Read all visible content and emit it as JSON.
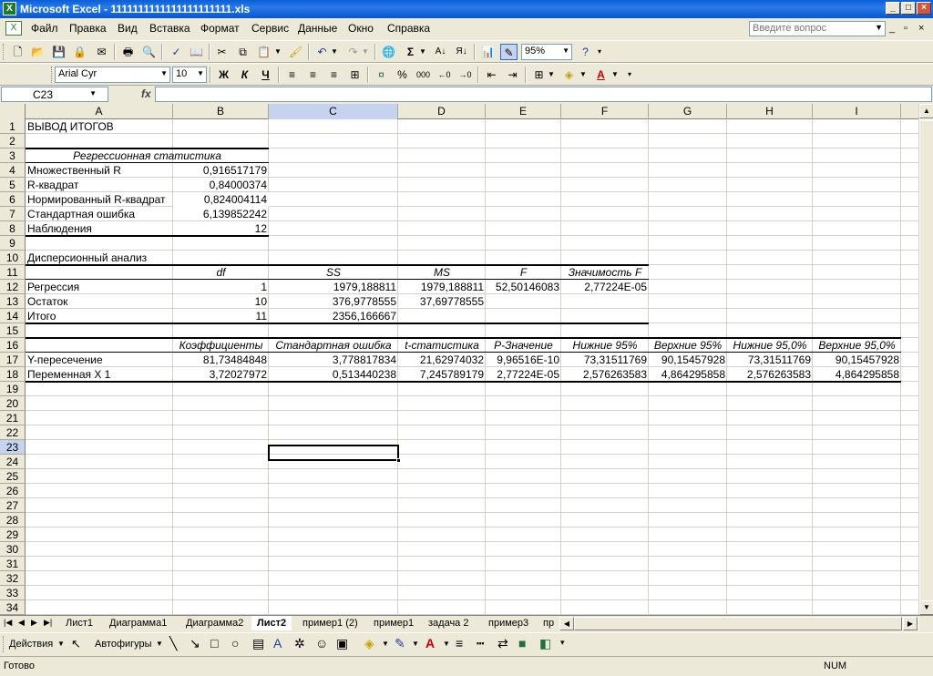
{
  "window": {
    "title": "Microsoft Excel - 1111111111111111111111.xls",
    "icon": "excel-icon"
  },
  "menu": {
    "items": [
      "Файл",
      "Правка",
      "Вид",
      "Вставка",
      "Формат",
      "Сервис",
      "Данные",
      "Окно",
      "Справка"
    ],
    "ask_placeholder": "Введите вопрос"
  },
  "toolbar": {
    "zoom": "95%"
  },
  "formatbar": {
    "font": "Arial Cyr",
    "size": "10",
    "bold": "Ж",
    "italic": "К",
    "underline": "Ч",
    "percent": "%",
    "thousands": "000"
  },
  "formula_bar": {
    "name_box": "C23",
    "fx": "fx",
    "formula": ""
  },
  "columns": [
    "A",
    "B",
    "C",
    "D",
    "E",
    "F",
    "G",
    "H",
    "I"
  ],
  "selected_column": "C",
  "rows": [
    "1",
    "2",
    "3",
    "4",
    "5",
    "6",
    "7",
    "8",
    "9",
    "10",
    "11",
    "12",
    "13",
    "14",
    "15",
    "16",
    "17",
    "18",
    "19",
    "20",
    "21",
    "22",
    "23",
    "24",
    "25",
    "26",
    "27",
    "28",
    "29",
    "30",
    "31",
    "32",
    "33",
    "34"
  ],
  "selected_row": "23",
  "cells": {
    "r1": {
      "A": "ВЫВОД ИТОГОВ"
    },
    "r3": {
      "A": "Регрессионная статистика"
    },
    "r4": {
      "A": "Множественный R",
      "B": "0,916517179"
    },
    "r5": {
      "A": "R-квадрат",
      "B": "0,84000374"
    },
    "r6": {
      "A": "Нормированный R-квадрат",
      "B": "0,824004114"
    },
    "r7": {
      "A": "Стандартная ошибка",
      "B": "6,139852242"
    },
    "r8": {
      "A": "Наблюдения",
      "B": "12"
    },
    "r10": {
      "A": "Дисперсионный анализ"
    },
    "r11": {
      "B": "df",
      "C": "SS",
      "D": "MS",
      "E": "F",
      "F": "Значимость F"
    },
    "r12": {
      "A": "Регрессия",
      "B": "1",
      "C": "1979,188811",
      "D": "1979,188811",
      "E": "52,50146083",
      "F": "2,77224E-05"
    },
    "r13": {
      "A": "Остаток",
      "B": "10",
      "C": "376,9778555",
      "D": "37,69778555"
    },
    "r14": {
      "A": "Итого",
      "B": "11",
      "C": "2356,166667"
    },
    "r16": {
      "B": "Коэффициенты",
      "C": "Стандартная ошибка",
      "D": "t-статистика",
      "E": "P-Значение",
      "F": "Нижние 95%",
      "G": "Верхние 95%",
      "H": "Нижние 95,0%",
      "I": "Верхние 95,0%"
    },
    "r17": {
      "A": "Y-пересечение",
      "B": "81,73484848",
      "C": "3,778817834",
      "D": "21,62974032",
      "E": "9,96516E-10",
      "F": "73,31511769",
      "G": "90,15457928",
      "H": "73,31511769",
      "I": "90,15457928"
    },
    "r18": {
      "A": "Переменная X 1",
      "B": "3,72027972",
      "C": "0,513440238",
      "D": "7,245789179",
      "E": "2,77224E-05",
      "F": "2,576263583",
      "G": "4,864295858",
      "H": "2,576263583",
      "I": "4,864295858"
    }
  },
  "sheet_tabs": [
    "Лист1",
    "Диаграмма1",
    "Диаграмма2",
    "Лист2",
    "пример1 (2)",
    "пример1",
    "задача 2",
    "пример3",
    "пр"
  ],
  "active_tab": "Лист2",
  "drawbar": {
    "actions": "Действия",
    "autoshapes": "Автофигуры"
  },
  "status": {
    "text": "Готово",
    "num": "NUM"
  }
}
